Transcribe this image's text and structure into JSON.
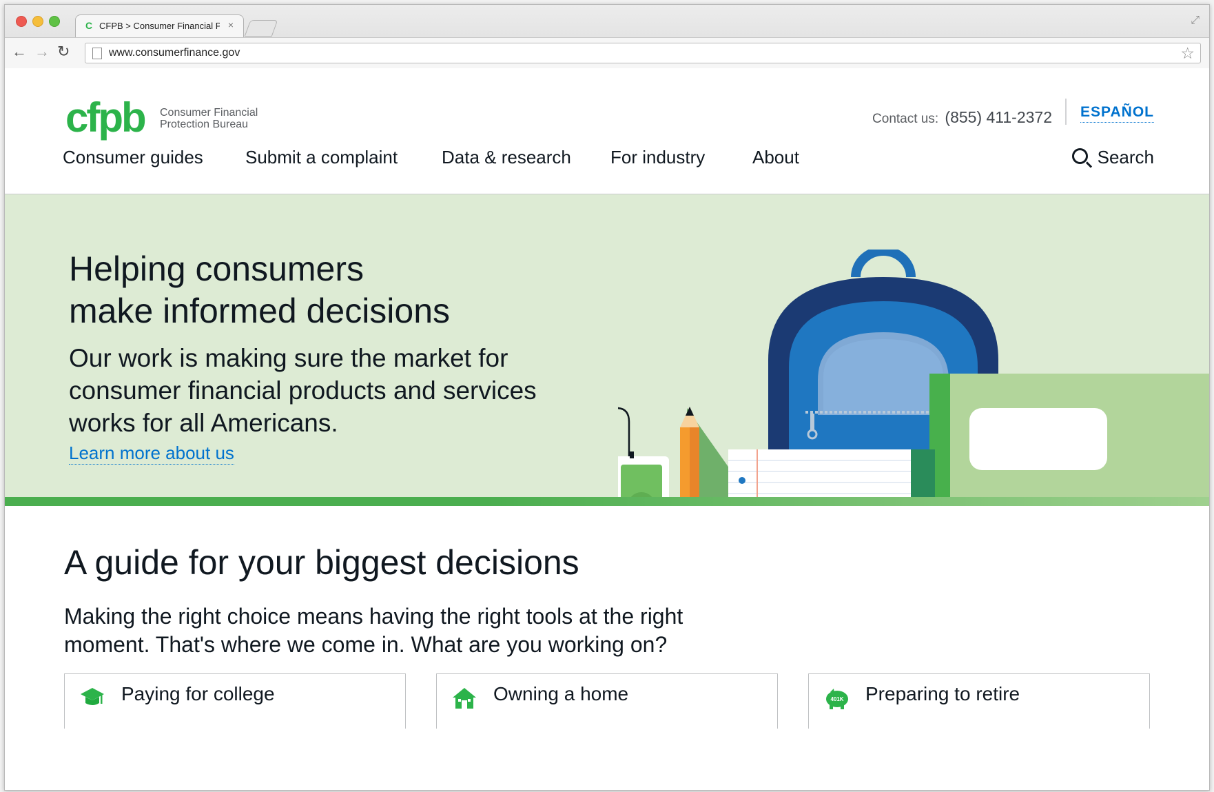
{
  "browser": {
    "tab_favicon": "C",
    "tab_title": "CFPB > Consumer Financial Protection Bureau",
    "tab_close": "×",
    "url": "www.consumerfinance.gov",
    "back_icon": "←",
    "forward_icon": "→",
    "reload_icon": "↻",
    "star_icon": "☆",
    "resize_icon": "⤢"
  },
  "header": {
    "logo_mark": "cfpb",
    "logo_text_line1": "Consumer Financial",
    "logo_text_line2": "Protection Bureau",
    "contact_label": "Contact us:",
    "contact_phone": "(855) 411-2372",
    "language_link": "ESPAÑOL"
  },
  "nav": {
    "items": [
      {
        "label": "Consumer guides"
      },
      {
        "label": "Submit a complaint"
      },
      {
        "label": "Data & research"
      },
      {
        "label": "For industry"
      },
      {
        "label": "About"
      }
    ],
    "search_label": "Search"
  },
  "hero": {
    "heading_line1": "Helping consumers",
    "heading_line2": "make informed decisions",
    "body": "Our work is making sure the market for consumer financial products and services works for all Americans.",
    "link": "Learn more about us"
  },
  "guide": {
    "title": "A guide for your biggest decisions",
    "body": "Making the right choice means having the right tools at the right moment. That's where we come in. What are you working on?",
    "cards": [
      {
        "label": "Paying for college",
        "icon": "graduation-cap-icon"
      },
      {
        "label": "Owning a home",
        "icon": "house-icon"
      },
      {
        "label": "Preparing to retire",
        "icon": "piggy-bank-icon",
        "icon_text": "401K"
      }
    ]
  },
  "colors": {
    "brand_green": "#2cb34a",
    "link_blue": "#0072ce",
    "hero_bg": "#ddebd4",
    "text": "#101820"
  }
}
